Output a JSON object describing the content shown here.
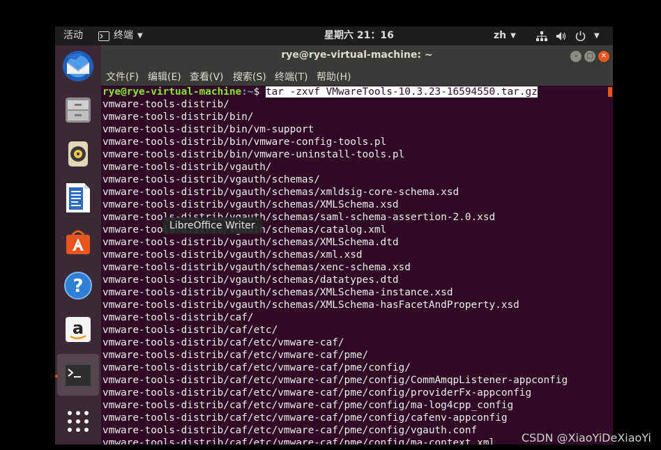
{
  "topbar": {
    "activities": "活动",
    "app_menu": "终端",
    "clock": "星期六 21：16",
    "input_method": "zh"
  },
  "dock": {
    "tooltip": "LibreOffice Writer",
    "items": [
      {
        "name": "thunderbird-icon"
      },
      {
        "name": "files-icon"
      },
      {
        "name": "rhythmbox-icon"
      },
      {
        "name": "libreoffice-writer-icon"
      },
      {
        "name": "software-center-icon"
      },
      {
        "name": "help-icon"
      },
      {
        "name": "amazon-icon"
      },
      {
        "name": "terminal-icon"
      },
      {
        "name": "show-apps-icon"
      }
    ]
  },
  "window": {
    "title": "rye@rye-virtual-machine: ~",
    "menus": [
      "文件(F)",
      "编辑(E)",
      "查看(V)",
      "搜索(S)",
      "终端(T)",
      "帮助(H)"
    ]
  },
  "terminal": {
    "prompt_user": "rye@rye-virtual-machine",
    "prompt_path": ":~",
    "prompt_sign": "$ ",
    "command": "tar -zxvf VMwareTools-10.3.23-16594550.tar.gz",
    "output": [
      "vmware-tools-distrib/",
      "vmware-tools-distrib/bin/",
      "vmware-tools-distrib/bin/vm-support",
      "vmware-tools-distrib/bin/vmware-config-tools.pl",
      "vmware-tools-distrib/bin/vmware-uninstall-tools.pl",
      "vmware-tools-distrib/vgauth/",
      "vmware-tools-distrib/vgauth/schemas/",
      "vmware-tools-distrib/vgauth/schemas/xmldsig-core-schema.xsd",
      "vmware-tools-distrib/vgauth/schemas/XMLSchema.xsd",
      "vmware-tools-distrib/vgauth/schemas/saml-schema-assertion-2.0.xsd",
      "vmware-tools-distrib/vgauth/schemas/catalog.xml",
      "vmware-tools-distrib/vgauth/schemas/XMLSchema.dtd",
      "vmware-tools-distrib/vgauth/schemas/xml.xsd",
      "vmware-tools-distrib/vgauth/schemas/xenc-schema.xsd",
      "vmware-tools-distrib/vgauth/schemas/datatypes.dtd",
      "vmware-tools-distrib/vgauth/schemas/XMLSchema-instance.xsd",
      "vmware-tools-distrib/vgauth/schemas/XMLSchema-hasFacetAndProperty.xsd",
      "vmware-tools-distrib/caf/",
      "vmware-tools-distrib/caf/etc/",
      "vmware-tools-distrib/caf/etc/vmware-caf/",
      "vmware-tools-distrib/caf/etc/vmware-caf/pme/",
      "vmware-tools-distrib/caf/etc/vmware-caf/pme/config/",
      "vmware-tools-distrib/caf/etc/vmware-caf/pme/config/CommAmqpListener-appconfig",
      "vmware-tools-distrib/caf/etc/vmware-caf/pme/config/providerFx-appconfig",
      "vmware-tools-distrib/caf/etc/vmware-caf/pme/config/ma-log4cpp_config",
      "vmware-tools-distrib/caf/etc/vmware-caf/pme/config/cafenv-appconfig",
      "vmware-tools-distrib/caf/etc/vmware-caf/pme/config/vgauth.conf",
      "vmware-tools-distrib/caf/etc/vmware-caf/pme/config/ma-context.xml"
    ]
  },
  "watermark": "CSDN @XiaoYiDeXiaoYi",
  "colors": {
    "terminal_bg": "#300a24",
    "prompt_user": "#8ae234",
    "prompt_path": "#729fcf",
    "accent": "#e95420"
  }
}
